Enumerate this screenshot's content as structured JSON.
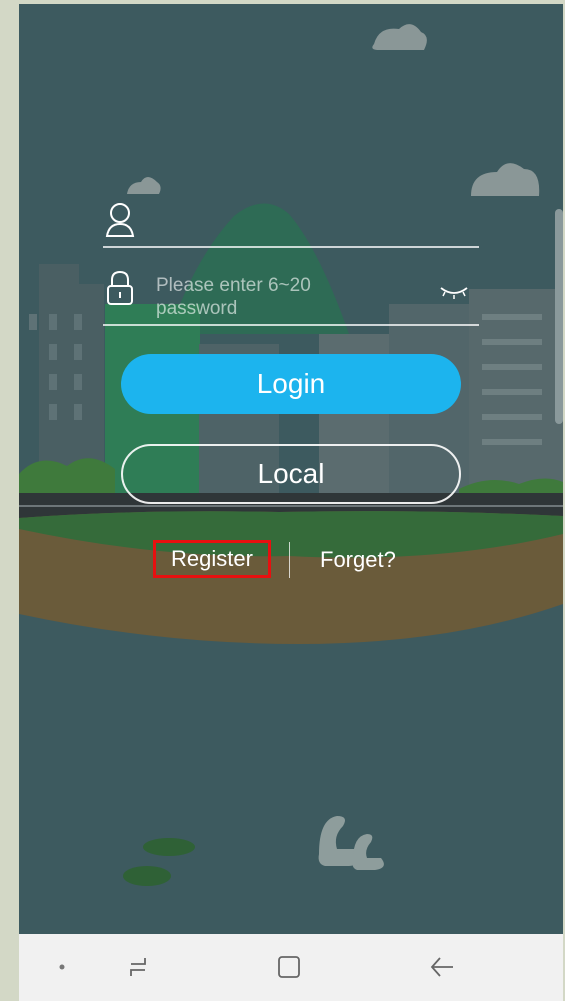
{
  "login_form": {
    "password_placeholder": "Please enter 6~20 password",
    "login_label": "Login",
    "local_label": "Local",
    "register_label": "Register",
    "forget_label": "Forget?"
  },
  "icons": {
    "username": "user-icon",
    "password": "lock-icon",
    "visibility": "eye-closed-icon"
  },
  "navbar": {
    "items": [
      "dot-icon",
      "recent-apps-icon",
      "home-icon",
      "back-icon"
    ]
  },
  "colors": {
    "background": "#3d5a5f",
    "login_button": "#1cb4ee",
    "highlight_box": "#e81010",
    "navbar": "#f1f1f1"
  }
}
